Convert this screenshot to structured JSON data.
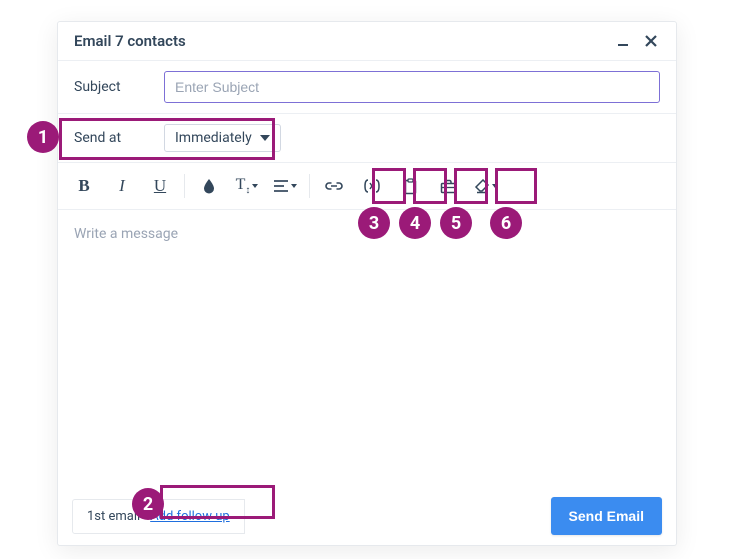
{
  "modal": {
    "title": "Email 7 contacts",
    "subject_label": "Subject",
    "subject_placeholder": "Enter Subject",
    "subject_value": "",
    "sendat_label": "Send at",
    "sendat_value": "Immediately",
    "editor_placeholder": "Write a message"
  },
  "toolbar": {
    "bold": "B",
    "italic": "I",
    "underline": "U",
    "color": "color-drop-icon",
    "textsize": "T",
    "align": "align-icon",
    "link": "link-icon",
    "variable": "variable-icon",
    "template": "clipboard-icon",
    "briefcase": "briefcase-icon",
    "erase": "erase-icon"
  },
  "footer": {
    "step_label": "1st email",
    "followup_label": "Add follow up",
    "send_label": "Send Email"
  },
  "callouts": {
    "c1": "1",
    "c2": "2",
    "c3": "3",
    "c4": "4",
    "c5": "5",
    "c6": "6"
  }
}
